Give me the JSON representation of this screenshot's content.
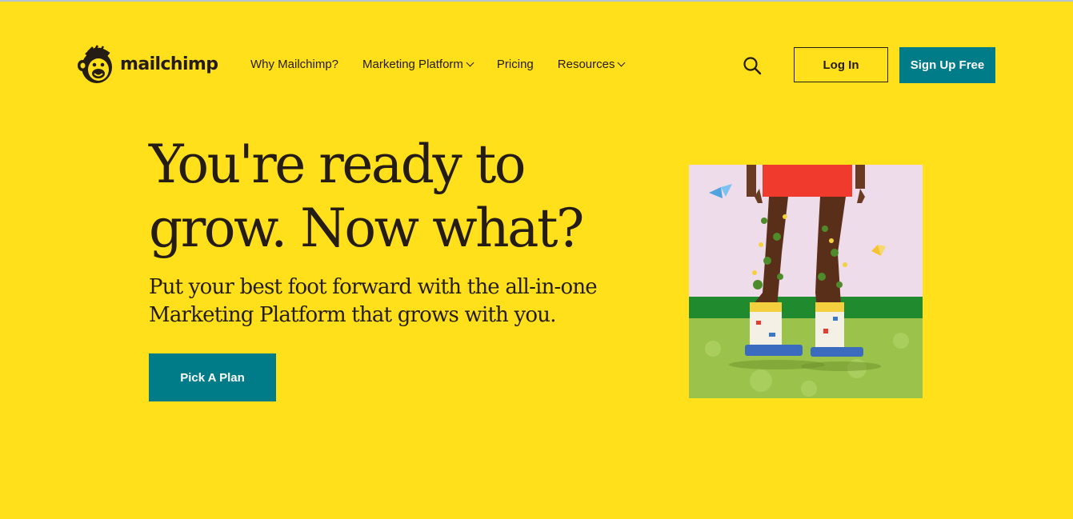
{
  "header": {
    "logo_text": "mailchimp",
    "nav": [
      {
        "label": "Why Mailchimp?",
        "has_dropdown": false
      },
      {
        "label": "Marketing Platform",
        "has_dropdown": true
      },
      {
        "label": "Pricing",
        "has_dropdown": false
      },
      {
        "label": "Resources",
        "has_dropdown": true
      }
    ],
    "search_icon": "search-icon",
    "login_label": "Log In",
    "signup_label": "Sign Up Free"
  },
  "hero": {
    "title": "You're ready to grow. Now what?",
    "subtitle": "Put your best foot forward with the all-in-one Marketing Platform that grows with you.",
    "cta_label": "Pick A Plan"
  },
  "colors": {
    "background": "#FFE01B",
    "accent": "#007C89",
    "text": "#241C15"
  }
}
